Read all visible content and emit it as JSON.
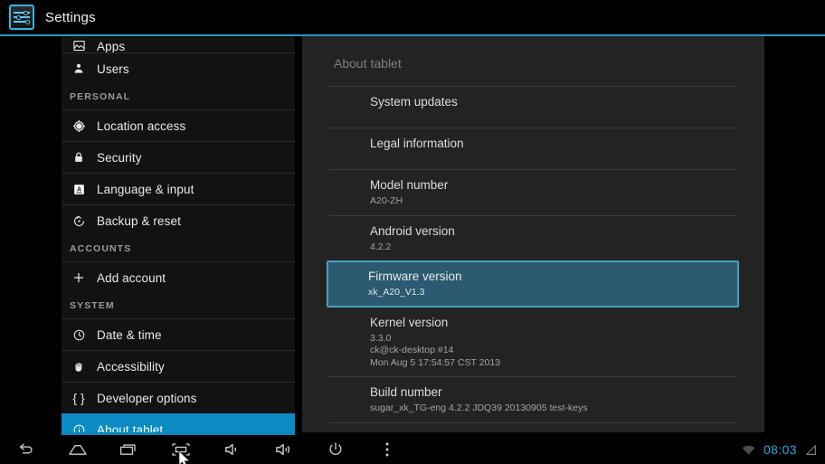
{
  "app": {
    "title": "Settings",
    "icon": "settings-sliders-icon",
    "accent_color": "#2596c9"
  },
  "sidebar": {
    "items": [
      {
        "label": "Apps",
        "icon": "apps-icon",
        "type": "item",
        "clipped": true
      },
      {
        "label": "Users",
        "icon": "user-icon",
        "type": "item"
      },
      {
        "label": "PERSONAL",
        "type": "header"
      },
      {
        "label": "Location access",
        "icon": "location-crosshair-icon",
        "type": "item"
      },
      {
        "label": "Security",
        "icon": "lock-icon",
        "type": "item"
      },
      {
        "label": "Language & input",
        "icon": "letter-a-box-icon",
        "type": "item"
      },
      {
        "label": "Backup & reset",
        "icon": "backup-restore-icon",
        "type": "item"
      },
      {
        "label": "ACCOUNTS",
        "type": "header"
      },
      {
        "label": "Add account",
        "icon": "plus-icon",
        "type": "item"
      },
      {
        "label": "SYSTEM",
        "type": "header"
      },
      {
        "label": "Date & time",
        "icon": "clock-icon",
        "type": "item"
      },
      {
        "label": "Accessibility",
        "icon": "hand-icon",
        "type": "item"
      },
      {
        "label": "Developer options",
        "icon": "braces-icon",
        "type": "item"
      },
      {
        "label": "About tablet",
        "icon": "info-circle-icon",
        "type": "item",
        "selected": true
      }
    ],
    "selected_color": "#0a8bc2"
  },
  "content": {
    "title": "About tablet",
    "selected_color": "#2c5a70",
    "selected_border_color": "#4b9ec2",
    "items": [
      {
        "title": "System updates",
        "sub": ""
      },
      {
        "title": "Legal information",
        "sub": ""
      },
      {
        "title": "Model number",
        "sub": "A20-ZH"
      },
      {
        "title": "Android version",
        "sub": "4.2.2"
      },
      {
        "title": "Firmware version",
        "sub": "xk_A20_V1.3",
        "selected": true
      },
      {
        "title": "Kernel version",
        "sub": "3.3.0\nck@ck-desktop #14\nMon Aug 5 17:54:57 CST 2013"
      },
      {
        "title": "Build number",
        "sub": "sugar_xk_TG-eng 4.2.2 JDQ39 20130905 test-keys"
      }
    ]
  },
  "navbar": {
    "buttons": [
      {
        "name": "back-icon",
        "label": "Back"
      },
      {
        "name": "home-icon",
        "label": "Home"
      },
      {
        "name": "recents-icon",
        "label": "Recent apps"
      },
      {
        "name": "screenshot-icon",
        "label": "Screenshot"
      },
      {
        "name": "volume-down-icon",
        "label": "Volume down"
      },
      {
        "name": "volume-up-icon",
        "label": "Volume up"
      },
      {
        "name": "power-icon",
        "label": "Power"
      },
      {
        "name": "overflow-menu-icon",
        "label": "Menu"
      }
    ],
    "status": {
      "wifi_icon": "wifi-icon",
      "clock": "08:03",
      "clock_color": "#2ca8d6",
      "battery_icon": "battery-triangle-icon"
    }
  }
}
